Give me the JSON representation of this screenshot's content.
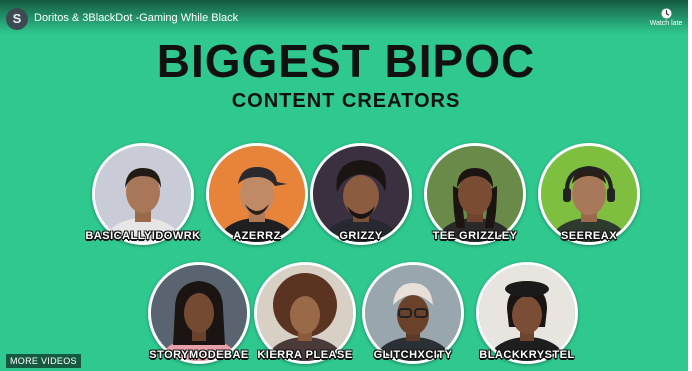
{
  "video": {
    "channel_initial": "S",
    "title": "Doritos & 3BlackDot -Gaming While Black",
    "watch_later_label": "Watch late",
    "more_videos_label": "MORE VIDEOS"
  },
  "slide": {
    "headline": "BIGGEST BIPOC",
    "subheadline": "CONTENT CREATORS",
    "background_color": "#2fc88f"
  },
  "creators": [
    {
      "name": "BASICALLYIDOWRK",
      "bg": "#c9ccd6"
    },
    {
      "name": "AZERRZ",
      "bg": "#e8843a"
    },
    {
      "name": "GRIZZY",
      "bg": "#3a3040"
    },
    {
      "name": "TEE GRIZZLEY",
      "bg": "#6a8a4a"
    },
    {
      "name": "SEEREAX",
      "bg": "#7fbf3f"
    },
    {
      "name": "STORYMODEBAE",
      "bg": "#5a6470"
    },
    {
      "name": "KIERRA PLEASE",
      "bg": "#d8d0c4"
    },
    {
      "name": "GLITCHXCITY",
      "bg": "#9aa6ad"
    },
    {
      "name": "BLACKKRYSTEL",
      "bg": "#e8e4e0"
    }
  ]
}
